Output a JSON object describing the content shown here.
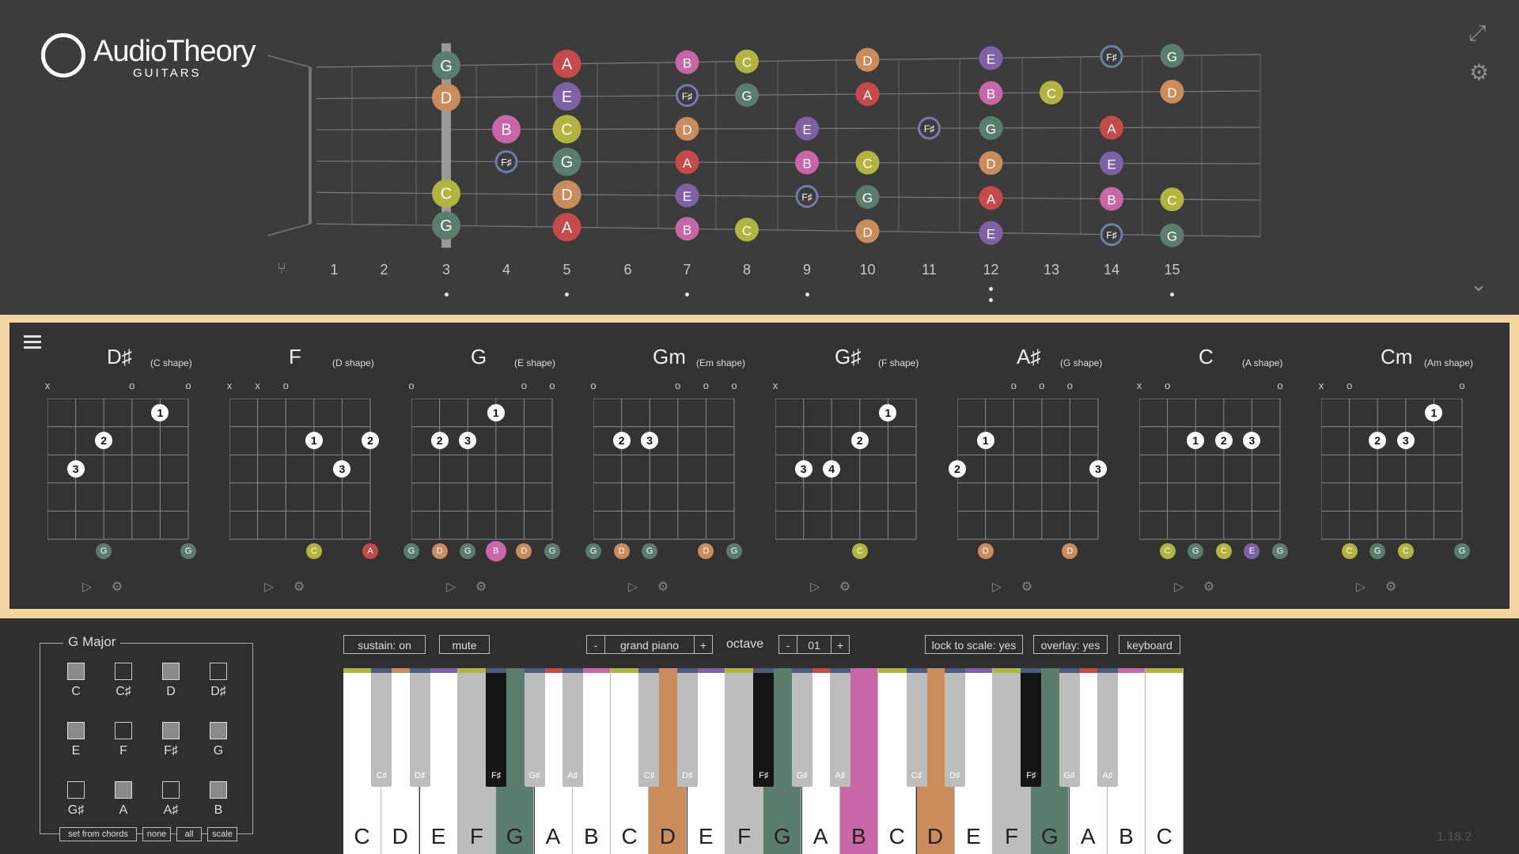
{
  "app": {
    "brand": "AudioTheory",
    "product": "GUITARS",
    "version": "1.18.2"
  },
  "colors": {
    "C": "#b1b43f",
    "D": "#c98c5a",
    "E": "#7d62a6",
    "F#": "#4e5a7a",
    "G": "#5b7d6e",
    "A": "#c74a4a",
    "B": "#c867a8",
    "C#": "#c2c2c2"
  },
  "fretboard": {
    "fret_numbers": [
      "1",
      "2",
      "3",
      "4",
      "5",
      "6",
      "7",
      "8",
      "9",
      "10",
      "11",
      "12",
      "13",
      "14",
      "15"
    ],
    "inlays": [
      3,
      5,
      7,
      9,
      12,
      15
    ],
    "capo_fret": 3,
    "notes": [
      {
        "fret": 3,
        "string": 1,
        "name": "G"
      },
      {
        "fret": 3,
        "string": 2,
        "name": "D"
      },
      {
        "fret": 3,
        "string": 5,
        "name": "C"
      },
      {
        "fret": 3,
        "string": 6,
        "name": "G"
      },
      {
        "fret": 4,
        "string": 3,
        "name": "B"
      },
      {
        "fret": 4,
        "string": 4,
        "name": "F♯"
      },
      {
        "fret": 5,
        "string": 1,
        "name": "A"
      },
      {
        "fret": 5,
        "string": 2,
        "name": "E"
      },
      {
        "fret": 5,
        "string": 3,
        "name": "C"
      },
      {
        "fret": 5,
        "string": 4,
        "name": "G"
      },
      {
        "fret": 5,
        "string": 5,
        "name": "D"
      },
      {
        "fret": 5,
        "string": 6,
        "name": "A"
      },
      {
        "fret": 7,
        "string": 1,
        "name": "B"
      },
      {
        "fret": 7,
        "string": 2,
        "name": "F♯"
      },
      {
        "fret": 7,
        "string": 3,
        "name": "D"
      },
      {
        "fret": 7,
        "string": 4,
        "name": "A"
      },
      {
        "fret": 7,
        "string": 5,
        "name": "E"
      },
      {
        "fret": 7,
        "string": 6,
        "name": "B"
      },
      {
        "fret": 8,
        "string": 1,
        "name": "C"
      },
      {
        "fret": 8,
        "string": 2,
        "name": "G"
      },
      {
        "fret": 8,
        "string": 6,
        "name": "C"
      },
      {
        "fret": 9,
        "string": 3,
        "name": "E"
      },
      {
        "fret": 9,
        "string": 4,
        "name": "B"
      },
      {
        "fret": 9,
        "string": 5,
        "name": "F♯"
      },
      {
        "fret": 10,
        "string": 1,
        "name": "D"
      },
      {
        "fret": 10,
        "string": 2,
        "name": "A"
      },
      {
        "fret": 10,
        "string": 4,
        "name": "C"
      },
      {
        "fret": 10,
        "string": 5,
        "name": "G"
      },
      {
        "fret": 10,
        "string": 6,
        "name": "D"
      },
      {
        "fret": 11,
        "string": 3,
        "name": "F♯"
      },
      {
        "fret": 12,
        "string": 1,
        "name": "E"
      },
      {
        "fret": 12,
        "string": 2,
        "name": "B"
      },
      {
        "fret": 12,
        "string": 3,
        "name": "G"
      },
      {
        "fret": 12,
        "string": 4,
        "name": "D"
      },
      {
        "fret": 12,
        "string": 5,
        "name": "A"
      },
      {
        "fret": 12,
        "string": 6,
        "name": "E"
      },
      {
        "fret": 13,
        "string": 2,
        "name": "C"
      },
      {
        "fret": 14,
        "string": 1,
        "name": "F♯"
      },
      {
        "fret": 14,
        "string": 3,
        "name": "A"
      },
      {
        "fret": 14,
        "string": 4,
        "name": "E"
      },
      {
        "fret": 14,
        "string": 5,
        "name": "B"
      },
      {
        "fret": 14,
        "string": 6,
        "name": "F♯"
      },
      {
        "fret": 15,
        "string": 1,
        "name": "G"
      },
      {
        "fret": 15,
        "string": 2,
        "name": "D"
      },
      {
        "fret": 15,
        "string": 5,
        "name": "C"
      },
      {
        "fret": 15,
        "string": 6,
        "name": "G"
      }
    ]
  },
  "chords": [
    {
      "name": "D♯",
      "shape": "(C shape)",
      "marks": [
        "x",
        "",
        "",
        "o",
        "",
        "o"
      ],
      "fingers": [
        {
          "s": 5,
          "f": 1,
          "n": "1"
        },
        {
          "s": 3,
          "f": 2,
          "n": "2"
        },
        {
          "s": 2,
          "f": 3,
          "n": "3"
        }
      ],
      "notes": [
        {
          "s": 3,
          "n": "G"
        },
        {
          "s": 6,
          "n": "G"
        }
      ]
    },
    {
      "name": "F",
      "shape": "(D shape)",
      "marks": [
        "x",
        "x",
        "o",
        "",
        "",
        ""
      ],
      "fingers": [
        {
          "s": 4,
          "f": 2,
          "n": "1"
        },
        {
          "s": 6,
          "f": 2,
          "n": "2"
        },
        {
          "s": 5,
          "f": 3,
          "n": "3"
        }
      ],
      "notes": [
        {
          "s": 4,
          "n": "C"
        },
        {
          "s": 6,
          "n": "A"
        }
      ]
    },
    {
      "name": "G",
      "shape": "(E shape)",
      "marks": [
        "o",
        "",
        "",
        "",
        "o",
        "o"
      ],
      "fingers": [
        {
          "s": 4,
          "f": 1,
          "n": "1"
        },
        {
          "s": 2,
          "f": 2,
          "n": "2"
        },
        {
          "s": 3,
          "f": 2,
          "n": "3"
        }
      ],
      "notes": [
        {
          "s": 1,
          "n": "G"
        },
        {
          "s": 2,
          "n": "D"
        },
        {
          "s": 3,
          "n": "G"
        },
        {
          "s": 4,
          "n": "B"
        },
        {
          "s": 5,
          "n": "D"
        },
        {
          "s": 6,
          "n": "G"
        }
      ]
    },
    {
      "name": "Gm",
      "shape": "(Em shape)",
      "marks": [
        "o",
        "",
        "",
        "o",
        "o",
        "o"
      ],
      "fingers": [
        {
          "s": 2,
          "f": 2,
          "n": "2"
        },
        {
          "s": 3,
          "f": 2,
          "n": "3"
        }
      ],
      "notes": [
        {
          "s": 1,
          "n": "G"
        },
        {
          "s": 2,
          "n": "D"
        },
        {
          "s": 3,
          "n": "G"
        },
        {
          "s": 5,
          "n": "D"
        },
        {
          "s": 6,
          "n": "G"
        }
      ]
    },
    {
      "name": "G♯",
      "shape": "(F shape)",
      "marks": [
        "x",
        "",
        "",
        "",
        "",
        ""
      ],
      "fingers": [
        {
          "s": 5,
          "f": 1,
          "n": "1"
        },
        {
          "s": 4,
          "f": 2,
          "n": "2"
        },
        {
          "s": 2,
          "f": 3,
          "n": "3"
        },
        {
          "s": 3,
          "f": 3,
          "n": "4"
        }
      ],
      "notes": [
        {
          "s": 4,
          "n": "C"
        }
      ]
    },
    {
      "name": "A♯",
      "shape": "(G shape)",
      "marks": [
        "",
        "",
        "o",
        "o",
        "o",
        ""
      ],
      "fingers": [
        {
          "s": 2,
          "f": 2,
          "n": "1"
        },
        {
          "s": 1,
          "f": 3,
          "n": "2"
        },
        {
          "s": 6,
          "f": 3,
          "n": "3"
        }
      ],
      "notes": [
        {
          "s": 2,
          "n": "D"
        },
        {
          "s": 5,
          "n": "D"
        }
      ]
    },
    {
      "name": "C",
      "shape": "(A shape)",
      "marks": [
        "x",
        "o",
        "",
        "",
        "",
        "o"
      ],
      "fingers": [
        {
          "s": 3,
          "f": 2,
          "n": "1"
        },
        {
          "s": 4,
          "f": 2,
          "n": "2"
        },
        {
          "s": 5,
          "f": 2,
          "n": "3"
        }
      ],
      "notes": [
        {
          "s": 2,
          "n": "C"
        },
        {
          "s": 3,
          "n": "G"
        },
        {
          "s": 4,
          "n": "C"
        },
        {
          "s": 5,
          "n": "E"
        },
        {
          "s": 6,
          "n": "G"
        }
      ]
    },
    {
      "name": "Cm",
      "shape": "(Am shape)",
      "marks": [
        "x",
        "o",
        "",
        "",
        "",
        "o"
      ],
      "fingers": [
        {
          "s": 5,
          "f": 1,
          "n": "1"
        },
        {
          "s": 3,
          "f": 2,
          "n": "2"
        },
        {
          "s": 4,
          "f": 2,
          "n": "3"
        }
      ],
      "notes": [
        {
          "s": 2,
          "n": "C"
        },
        {
          "s": 3,
          "n": "G"
        },
        {
          "s": 4,
          "n": "C"
        },
        {
          "s": 6,
          "n": "G"
        }
      ]
    }
  ],
  "scale": {
    "title": "G Major",
    "pitch_classes": [
      {
        "name": "C",
        "on": true
      },
      {
        "name": "C♯",
        "on": false
      },
      {
        "name": "D",
        "on": true
      },
      {
        "name": "D♯",
        "on": false
      },
      {
        "name": "E",
        "on": true
      },
      {
        "name": "F",
        "on": false
      },
      {
        "name": "F♯",
        "on": true
      },
      {
        "name": "G",
        "on": true
      },
      {
        "name": "G♯",
        "on": false
      },
      {
        "name": "A",
        "on": true
      },
      {
        "name": "A♯",
        "on": false
      },
      {
        "name": "B",
        "on": true
      }
    ],
    "buttons": {
      "set_from_chords": "set from chords",
      "none": "none",
      "all": "all",
      "scale": "scale"
    }
  },
  "toolbar": {
    "sustain": "sustain: on",
    "mute": "mute",
    "minus": "-",
    "plus": "+",
    "instrument": "grand piano",
    "octave_label": "octave",
    "octave_value": "01",
    "lock": "lock to scale: yes",
    "overlay": "overlay: yes",
    "keyboard": "keyboard"
  },
  "keyboard": {
    "white_keys": [
      {
        "n": "C",
        "hl": null
      },
      {
        "n": "D",
        "hl": null
      },
      {
        "n": "E",
        "hl": null
      },
      {
        "n": "F",
        "hl": "gray"
      },
      {
        "n": "G",
        "hl": "G"
      },
      {
        "n": "A",
        "hl": null
      },
      {
        "n": "B",
        "hl": null
      },
      {
        "n": "C",
        "hl": null
      },
      {
        "n": "D",
        "hl": "D"
      },
      {
        "n": "E",
        "hl": null
      },
      {
        "n": "F",
        "hl": "gray"
      },
      {
        "n": "G",
        "hl": "G"
      },
      {
        "n": "A",
        "hl": null
      },
      {
        "n": "B",
        "hl": "B"
      },
      {
        "n": "C",
        "hl": null
      },
      {
        "n": "D",
        "hl": "D"
      },
      {
        "n": "E",
        "hl": null
      },
      {
        "n": "F",
        "hl": "gray"
      },
      {
        "n": "G",
        "hl": "G"
      },
      {
        "n": "A",
        "hl": null
      },
      {
        "n": "B",
        "hl": null
      },
      {
        "n": "C",
        "hl": null
      }
    ],
    "black_keys": [
      {
        "n": "C♯",
        "after": 0,
        "hl": "gray"
      },
      {
        "n": "D♯",
        "after": 1,
        "hl": "gray"
      },
      {
        "n": "F♯",
        "after": 3,
        "hl": "black"
      },
      {
        "n": "G♯",
        "after": 4,
        "hl": "gray"
      },
      {
        "n": "A♯",
        "after": 5,
        "hl": "gray"
      },
      {
        "n": "C♯",
        "after": 7,
        "hl": "gray"
      },
      {
        "n": "D♯",
        "after": 8,
        "hl": "gray"
      },
      {
        "n": "F♯",
        "after": 10,
        "hl": "black"
      },
      {
        "n": "G♯",
        "after": 11,
        "hl": "gray"
      },
      {
        "n": "A♯",
        "after": 12,
        "hl": "gray"
      },
      {
        "n": "C♯",
        "after": 14,
        "hl": "gray"
      },
      {
        "n": "D♯",
        "after": 15,
        "hl": "gray"
      },
      {
        "n": "F♯",
        "after": 17,
        "hl": "black"
      },
      {
        "n": "G♯",
        "after": 18,
        "hl": "gray"
      },
      {
        "n": "A♯",
        "after": 19,
        "hl": "gray"
      }
    ]
  }
}
